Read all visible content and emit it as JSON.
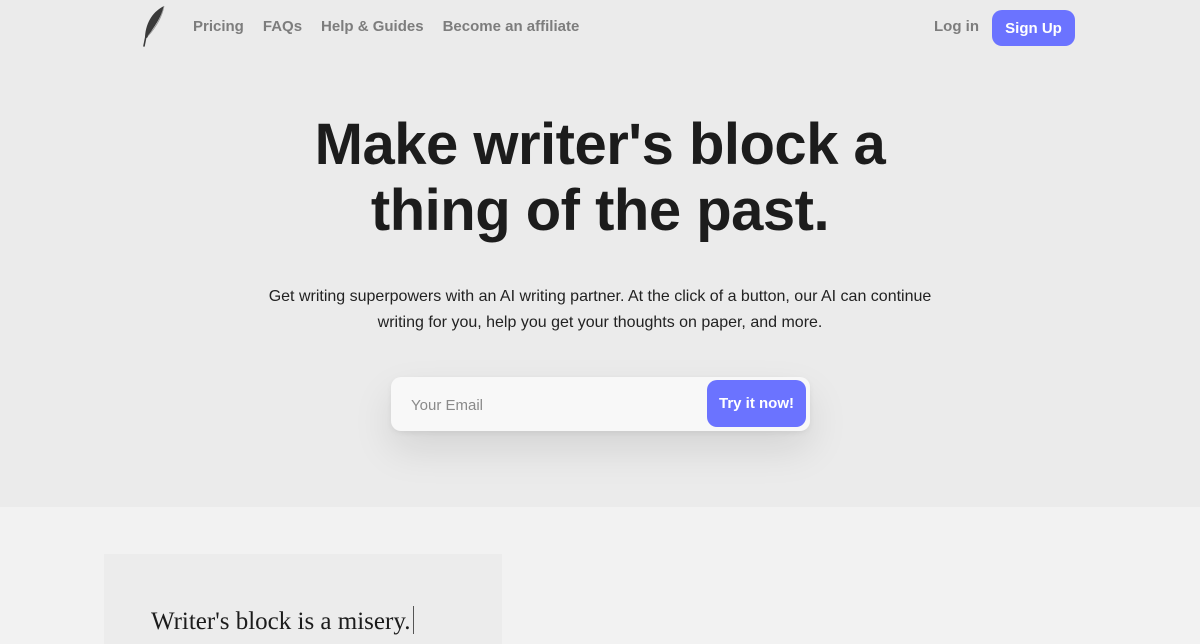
{
  "nav": {
    "logo_icon": "feather-icon",
    "links": [
      "Pricing",
      "FAQs",
      "Help & Guides",
      "Become an affiliate"
    ],
    "login_label": "Log in",
    "signup_label": "Sign Up"
  },
  "hero": {
    "headline_line1": "Make writer's block a",
    "headline_line2": "thing of the past.",
    "subtext_line1": "Get writing superpowers with an AI writing partner. At the click of a button, our AI can continue",
    "subtext_line2": "writing for you, help you get your thoughts on paper, and more.",
    "email_placeholder": "Your Email",
    "email_value": "",
    "cta_label": "Try it now!"
  },
  "editor": {
    "text": "Writer's block is a misery."
  },
  "colors": {
    "accent": "#6b73ff",
    "hero_bg": "#ebebeb",
    "page_bg": "#f2f2f2",
    "nav_text": "#7d7d7d",
    "heading": "#1c1c1c"
  }
}
